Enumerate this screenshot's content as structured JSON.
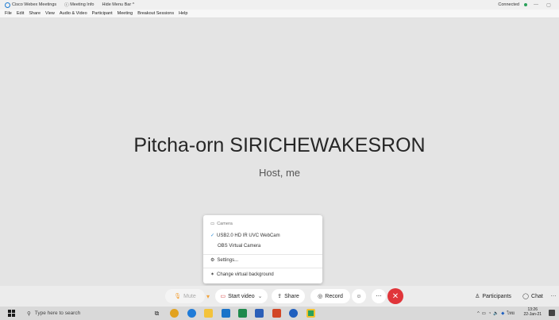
{
  "titlebar": {
    "app_name": "Cisco Webex Meetings",
    "meeting_info": "Meeting Info",
    "hide_menu": "Hide Menu Bar ^",
    "status": "Connected",
    "status_color": "#2aa05a"
  },
  "menubar": {
    "items": [
      "File",
      "Edit",
      "Share",
      "View",
      "Audio & Video",
      "Participant",
      "Meeting",
      "Breakout Sessions",
      "Help"
    ]
  },
  "stage": {
    "participant_name": "Pitcha-orn SIRICHEWAKESRON",
    "participant_role": "Host, me"
  },
  "camera_menu": {
    "header": "Camera",
    "options": [
      "USB2.0 HD IR UVC WebCam",
      "OBS Virtual Camera"
    ],
    "selected_option": "USB2.0 HD IR UVC WebCam",
    "settings": "Settings...",
    "change_background": "Change virtual background"
  },
  "controls": {
    "mute": "Mute",
    "start_video": "Start video",
    "share": "Share",
    "record": "Record",
    "participants": "Participants",
    "chat": "Chat",
    "end_color": "#e0353a"
  },
  "taskbar": {
    "search_placeholder": "Type here to search",
    "tray_lang": "ไทย",
    "time": "13:26",
    "date": "22-Jan-21"
  }
}
